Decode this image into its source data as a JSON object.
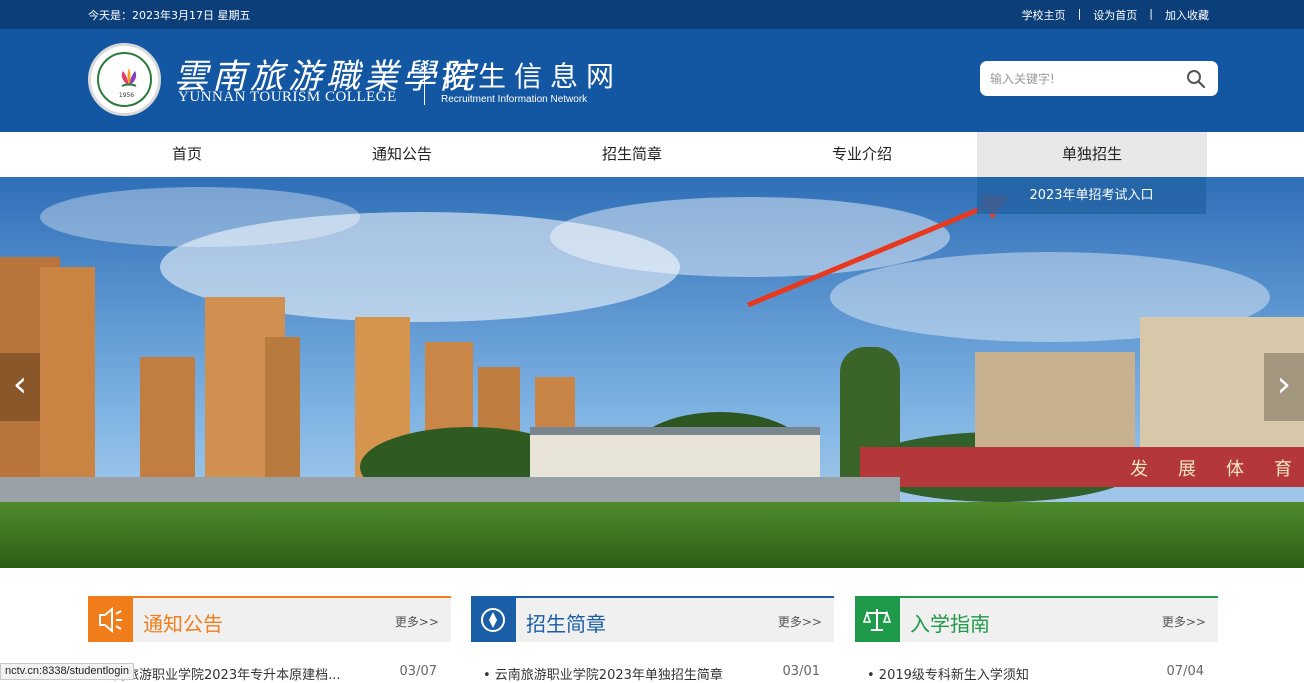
{
  "topbar": {
    "date": "今天是：2023年3月17日 星期五",
    "links": [
      "学校主页",
      "设为首页",
      "加入收藏"
    ],
    "separator": "|"
  },
  "header": {
    "cn_name": "雲南旅游職業學院",
    "en_name": "YUNNAN TOURISM COLLEGE",
    "site_title": "招生信息网",
    "site_subtitle": "Recruitment Information Network",
    "logo_year": "1956"
  },
  "search": {
    "placeholder": "输入关键字!",
    "icon": "search-icon"
  },
  "nav": {
    "items": [
      "首页",
      "通知公告",
      "招生简章",
      "专业介绍",
      "单独招生"
    ],
    "active": "单独招生",
    "dropdown_item": "2023年单招考试入口"
  },
  "banner": {
    "prev": "‹",
    "next": "›",
    "sign_text": "发展体育"
  },
  "panels": [
    {
      "title": "通知公告",
      "more": "更多>>",
      "icon": "speaker-icon",
      "color": "#f07d1a",
      "item": "云南旅游职业学院2023年专升本原建档...",
      "date": "03/07"
    },
    {
      "title": "招生简章",
      "more": "更多>>",
      "icon": "compass-icon",
      "color": "#1b5ea8",
      "item": "• 云南旅游职业学院2023年单独招生简章",
      "date": "03/01"
    },
    {
      "title": "入学指南",
      "more": "更多>>",
      "icon": "scales-icon",
      "color": "#1f9a4a",
      "item": "• 2019级专科新生入学须知",
      "date": "07/04"
    }
  ],
  "statusbar": {
    "url": "nctv.cn:8338/studentlogin"
  },
  "colors": {
    "topbar": "#0c3f79",
    "header": "#1356a2",
    "annotation_arrow": "#e8391e"
  }
}
